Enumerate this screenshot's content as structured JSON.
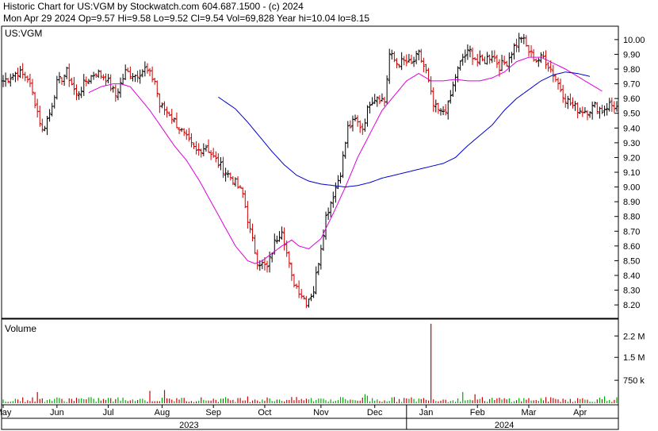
{
  "header": {
    "line1": "Historic Chart for US:VGM by Stockwatch.com 604.687.1500 - (c) 2024",
    "line2": "Mon Apr 29 2024  Op=9.57  Hi=9.58  Lo=9.52  Cl=9.54  Vol=69,828  Year hi=10.04  lo=8.15"
  },
  "colors": {
    "price_bar": "#000000",
    "price_bar_accent": "#cc0000",
    "ma_fast": "#dd00dd",
    "ma_slow": "#0000cc",
    "volume_bar_down": "#cc0000",
    "volume_bar_up": "#00aa00",
    "grid": "#000000"
  },
  "chart_data": [
    {
      "type": "line",
      "name": "price-panel",
      "title": "US:VGM",
      "ylim": [
        8.12,
        10.08
      ],
      "y_ticks": [
        "10.00",
        "9.90",
        "9.80",
        "9.70",
        "9.60",
        "9.50",
        "9.40",
        "9.30",
        "9.20",
        "9.10",
        "9.00",
        "8.90",
        "8.80",
        "8.70",
        "8.60",
        "8.50",
        "8.40",
        "8.30",
        "8.20"
      ],
      "y_tick_values": [
        10.0,
        9.9,
        9.8,
        9.7,
        9.6,
        9.5,
        9.4,
        9.3,
        9.2,
        9.1,
        9.0,
        8.9,
        8.8,
        8.7,
        8.6,
        8.5,
        8.4,
        8.3,
        8.2
      ],
      "x_month_labels": [
        "May",
        "Jun",
        "Jul",
        "Aug",
        "Sep",
        "Oct",
        "Nov",
        "Dec",
        "Jan",
        "Feb",
        "Mar",
        "Apr"
      ],
      "x_month_index": [
        0,
        22,
        43,
        65,
        86,
        107,
        130,
        152,
        173,
        194,
        215,
        236
      ],
      "x_year_labels": [
        "2023",
        "2024"
      ],
      "x_year_index": [
        76,
        205
      ],
      "year_divider_index": 165,
      "n_days": 252,
      "close_anchors": [
        [
          0,
          9.72
        ],
        [
          6,
          9.78
        ],
        [
          10,
          9.74
        ],
        [
          13,
          9.58
        ],
        [
          16,
          9.38
        ],
        [
          19,
          9.5
        ],
        [
          22,
          9.7
        ],
        [
          26,
          9.78
        ],
        [
          30,
          9.62
        ],
        [
          34,
          9.72
        ],
        [
          38,
          9.78
        ],
        [
          42,
          9.74
        ],
        [
          46,
          9.62
        ],
        [
          50,
          9.78
        ],
        [
          54,
          9.76
        ],
        [
          58,
          9.8
        ],
        [
          62,
          9.72
        ],
        [
          64,
          9.55
        ],
        [
          68,
          9.5
        ],
        [
          72,
          9.4
        ],
        [
          76,
          9.3
        ],
        [
          79,
          9.24
        ],
        [
          83,
          9.28
        ],
        [
          86,
          9.2
        ],
        [
          90,
          9.12
        ],
        [
          94,
          9.05
        ],
        [
          98,
          8.95
        ],
        [
          101,
          8.7
        ],
        [
          104,
          8.5
        ],
        [
          108,
          8.45
        ],
        [
          111,
          8.62
        ],
        [
          114,
          8.72
        ],
        [
          116,
          8.55
        ],
        [
          118,
          8.38
        ],
        [
          121,
          8.3
        ],
        [
          124,
          8.22
        ],
        [
          127,
          8.3
        ],
        [
          129,
          8.5
        ],
        [
          132,
          8.8
        ],
        [
          135,
          8.95
        ],
        [
          138,
          9.1
        ],
        [
          141,
          9.4
        ],
        [
          144,
          9.45
        ],
        [
          147,
          9.4
        ],
        [
          150,
          9.58
        ],
        [
          153,
          9.62
        ],
        [
          156,
          9.58
        ],
        [
          158,
          9.9
        ],
        [
          161,
          9.84
        ],
        [
          164,
          9.85
        ],
        [
          167,
          9.83
        ],
        [
          170,
          9.9
        ],
        [
          173,
          9.78
        ],
        [
          176,
          9.55
        ],
        [
          179,
          9.5
        ],
        [
          182,
          9.55
        ],
        [
          185,
          9.75
        ],
        [
          188,
          9.88
        ],
        [
          191,
          9.92
        ],
        [
          194,
          9.85
        ],
        [
          197,
          9.86
        ],
        [
          200,
          9.9
        ],
        [
          203,
          9.82
        ],
        [
          206,
          9.85
        ],
        [
          209,
          9.95
        ],
        [
          212,
          10.02
        ],
        [
          215,
          9.92
        ],
        [
          218,
          9.86
        ],
        [
          221,
          9.88
        ],
        [
          224,
          9.8
        ],
        [
          227,
          9.7
        ],
        [
          230,
          9.6
        ],
        [
          233,
          9.55
        ],
        [
          236,
          9.52
        ],
        [
          239,
          9.52
        ],
        [
          242,
          9.55
        ],
        [
          245,
          9.52
        ],
        [
          248,
          9.56
        ],
        [
          251,
          9.54
        ]
      ],
      "ma_fast_anchors": [
        [
          35,
          9.64
        ],
        [
          40,
          9.68
        ],
        [
          45,
          9.7
        ],
        [
          48,
          9.7
        ],
        [
          52,
          9.68
        ],
        [
          55,
          9.62
        ],
        [
          60,
          9.52
        ],
        [
          65,
          9.4
        ],
        [
          70,
          9.28
        ],
        [
          75,
          9.18
        ],
        [
          80,
          9.05
        ],
        [
          85,
          8.9
        ],
        [
          90,
          8.75
        ],
        [
          95,
          8.6
        ],
        [
          100,
          8.5
        ],
        [
          103,
          8.48
        ],
        [
          106,
          8.5
        ],
        [
          110,
          8.55
        ],
        [
          114,
          8.6
        ],
        [
          118,
          8.64
        ],
        [
          121,
          8.6
        ],
        [
          125,
          8.58
        ],
        [
          130,
          8.65
        ],
        [
          135,
          8.82
        ],
        [
          140,
          9.0
        ],
        [
          145,
          9.2
        ],
        [
          150,
          9.36
        ],
        [
          155,
          9.52
        ],
        [
          160,
          9.62
        ],
        [
          165,
          9.72
        ],
        [
          170,
          9.77
        ],
        [
          175,
          9.72
        ],
        [
          180,
          9.72
        ],
        [
          185,
          9.73
        ],
        [
          190,
          9.72
        ],
        [
          195,
          9.72
        ],
        [
          200,
          9.74
        ],
        [
          205,
          9.78
        ],
        [
          210,
          9.85
        ],
        [
          215,
          9.88
        ],
        [
          220,
          9.88
        ],
        [
          225,
          9.84
        ],
        [
          230,
          9.8
        ],
        [
          235,
          9.75
        ],
        [
          240,
          9.7
        ],
        [
          245,
          9.65
        ]
      ],
      "ma_slow_anchors": [
        [
          88,
          9.61
        ],
        [
          95,
          9.53
        ],
        [
          100,
          9.44
        ],
        [
          105,
          9.34
        ],
        [
          110,
          9.24
        ],
        [
          115,
          9.15
        ],
        [
          120,
          9.08
        ],
        [
          125,
          9.04
        ],
        [
          130,
          9.02
        ],
        [
          135,
          9.01
        ],
        [
          140,
          9.0
        ],
        [
          145,
          9.01
        ],
        [
          150,
          9.03
        ],
        [
          155,
          9.06
        ],
        [
          160,
          9.08
        ],
        [
          165,
          9.1
        ],
        [
          170,
          9.12
        ],
        [
          175,
          9.14
        ],
        [
          180,
          9.16
        ],
        [
          185,
          9.2
        ],
        [
          190,
          9.28
        ],
        [
          195,
          9.35
        ],
        [
          200,
          9.42
        ],
        [
          205,
          9.52
        ],
        [
          210,
          9.6
        ],
        [
          215,
          9.66
        ],
        [
          220,
          9.72
        ],
        [
          225,
          9.76
        ],
        [
          230,
          9.78
        ],
        [
          235,
          9.77
        ],
        [
          240,
          9.75
        ]
      ]
    },
    {
      "type": "bar",
      "name": "volume-panel",
      "title": "Volume",
      "ylim": [
        0,
        2700000
      ],
      "y_ticks": [
        "2.2 M",
        "1.5 M",
        "750 k"
      ],
      "y_tick_values": [
        2200000,
        1500000,
        750000
      ],
      "spike_index": 175,
      "spike_value": 2600000,
      "typical_volume": 120000
    }
  ]
}
